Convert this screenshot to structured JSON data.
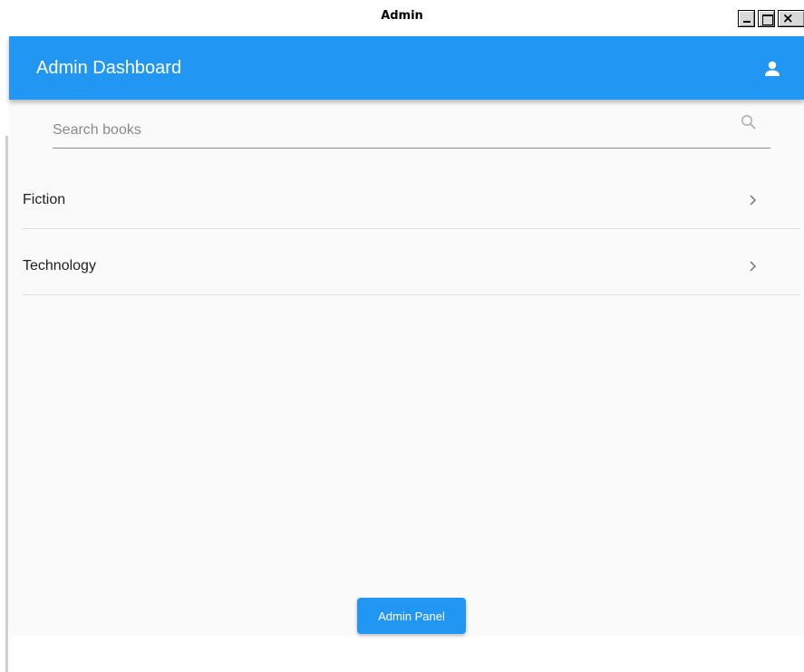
{
  "window": {
    "title": "Admin",
    "controls": {
      "minimize": "minimize-icon",
      "maximize": "maximize-icon",
      "close": "close-icon"
    }
  },
  "appbar": {
    "title": "Admin Dashboard",
    "account_icon": "account-icon",
    "color": "#2196f3"
  },
  "search": {
    "placeholder": "Search books",
    "value": "",
    "icon": "search-icon"
  },
  "categories": [
    {
      "label": "Fiction",
      "icon": "chevron-right-icon"
    },
    {
      "label": "Technology",
      "icon": "chevron-right-icon"
    }
  ],
  "footer": {
    "button_label": "Admin Panel"
  }
}
